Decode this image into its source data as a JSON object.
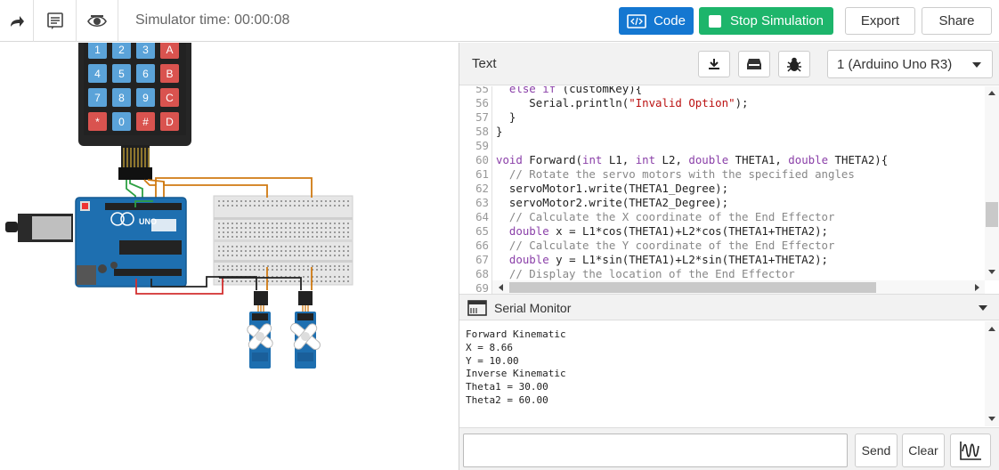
{
  "toolbar": {
    "sim_time": "Simulator time: 00:00:08",
    "code_label": "Code",
    "stop_label": "Stop Simulation",
    "export_label": "Export",
    "share_label": "Share",
    "colors": {
      "code": "#1477d1",
      "stop": "#1db56b"
    }
  },
  "code_panel": {
    "mode_label": "Text",
    "board": "1 (Arduino Uno R3)"
  },
  "editor": {
    "lines": [
      {
        "n": "55",
        "text": "  else if (customKey){"
      },
      {
        "n": "56",
        "text": "     Serial.println(\"Invalid Option\");"
      },
      {
        "n": "57",
        "text": "  }"
      },
      {
        "n": "58",
        "text": "}"
      },
      {
        "n": "59",
        "text": ""
      },
      {
        "n": "60",
        "text": "void Forward(int L1, int L2, double THETA1, double THETA2){"
      },
      {
        "n": "61",
        "text": "  // Rotate the servo motors with the specified angles"
      },
      {
        "n": "62",
        "text": "  servoMotor1.write(THETA1_Degree);"
      },
      {
        "n": "63",
        "text": "  servoMotor2.write(THETA2_Degree);"
      },
      {
        "n": "64",
        "text": "  // Calculate the X coordinate of the End Effector"
      },
      {
        "n": "65",
        "text": "  double x = L1*cos(THETA1)+L2*cos(THETA1+THETA2);"
      },
      {
        "n": "66",
        "text": "  // Calculate the Y coordinate of the End Effector"
      },
      {
        "n": "67",
        "text": "  double y = L1*sin(THETA1)+L2*sin(THETA1+THETA2);"
      },
      {
        "n": "68",
        "text": "  // Display the location of the End Effector"
      },
      {
        "n": "69",
        "text": ""
      }
    ]
  },
  "serial": {
    "title": "Serial Monitor",
    "lines": [
      "Forward Kinematic",
      "X = 8.66",
      "Y = 10.00",
      "Inverse Kinematic",
      "Theta1 = 30.00",
      "Theta2 = 60.00"
    ],
    "send_label": "Send",
    "clear_label": "Clear"
  },
  "circuit": {
    "keypad_keys": [
      "1",
      "2",
      "3",
      "A",
      "4",
      "5",
      "6",
      "B",
      "7",
      "8",
      "9",
      "C",
      "*",
      "0",
      "#",
      "D"
    ],
    "arduino_label": "UNO"
  }
}
